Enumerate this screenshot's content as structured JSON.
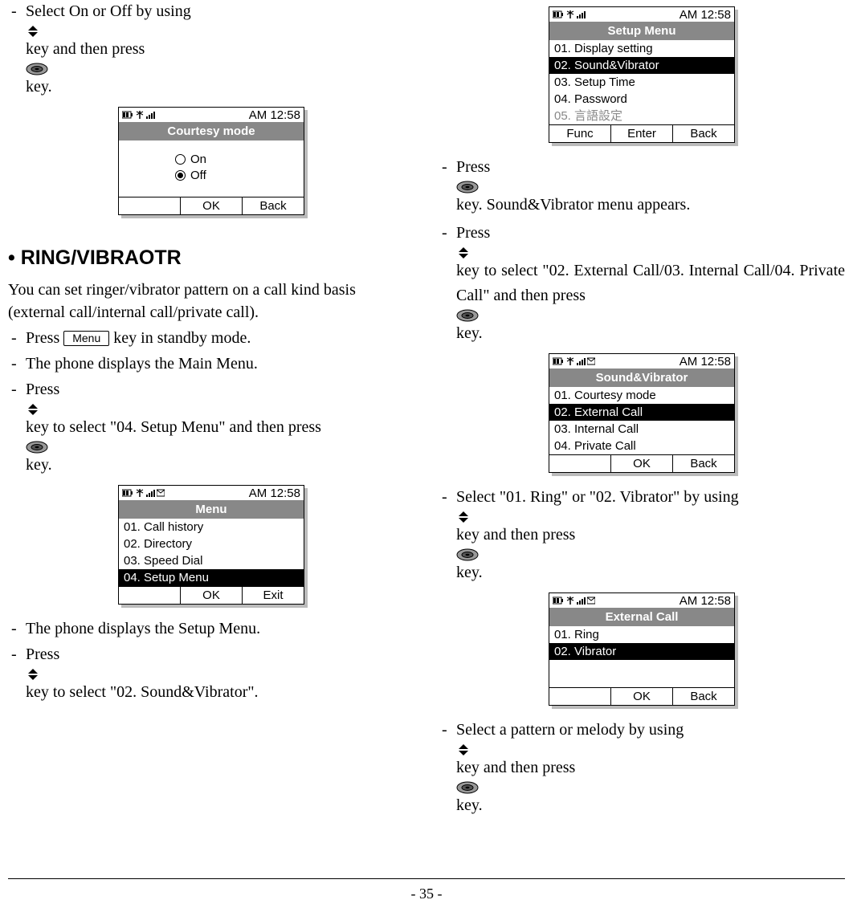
{
  "pagenum": "- 35 -",
  "heading": "RING/VIBRAOTR",
  "intro1": "You can set ringer/vibrator pattern on a call kind basis (external call/internal call/private call).",
  "left": {
    "step_onoff_a": "Select On or Off by using ",
    "step_onoff_b": " key and then press ",
    "step_onoff_c": " key.",
    "step_menu_a": "Press ",
    "step_menu_b": " key in standby mode.",
    "menu_label": "Menu",
    "step_mainmenu": "The phone displays the Main Menu.",
    "step_04_a": "Press ",
    "step_04_b": " key to select \"04. Setup Menu\" and then press ",
    "step_04_c": " key.",
    "step_setup": "The phone displays the Setup Menu.",
    "step_02_a": "Press ",
    "step_02_b": " key to select \"02. Sound&Vibrator\"."
  },
  "right": {
    "step_sv_a": "Press ",
    "step_sv_b": "  key. Sound&Vibrator menu appears.",
    "step_ext_a": "Press ",
    "step_ext_b": " key to select \"02. External Call/03. Internal Call/04. Private Call\" and then press ",
    "step_ext_c": " key.",
    "step_ring_a": "Select \"01. Ring\" or \"02. Vibrator\" by using ",
    "step_ring_b": " key and then press ",
    "step_ring_c": " key.",
    "step_pat_a": "Select a pattern or melody by using ",
    "step_pat_b": " key and then press ",
    "step_pat_c": " key."
  },
  "phone_time": "AM 12:58",
  "sk": {
    "ok": "OK",
    "back": "Back",
    "exit": "Exit",
    "func": "Func",
    "enter": "Enter"
  },
  "courtesy": {
    "title": "Courtesy mode",
    "on": "On",
    "off": "Off"
  },
  "menu_screen": {
    "title": "Menu",
    "i1": "01. Call history",
    "i2": "02. Directory",
    "i3": "03. Speed Dial",
    "i4": "04. Setup Menu"
  },
  "setup_screen": {
    "title": "Setup Menu",
    "i1": "01. Display setting",
    "i2": "02. Sound&Vibrator",
    "i3": "03. Setup Time",
    "i4": "04. Password",
    "i5": "05. 言語設定"
  },
  "sv_screen": {
    "title": "Sound&Vibrator",
    "i1": "01. Courtesy mode",
    "i2": "02. External Call",
    "i3": "03. Internal Call",
    "i4": "04. Private Call"
  },
  "ext_screen": {
    "title": "External Call",
    "i1": "01. Ring",
    "i2": "02. Vibrator"
  }
}
